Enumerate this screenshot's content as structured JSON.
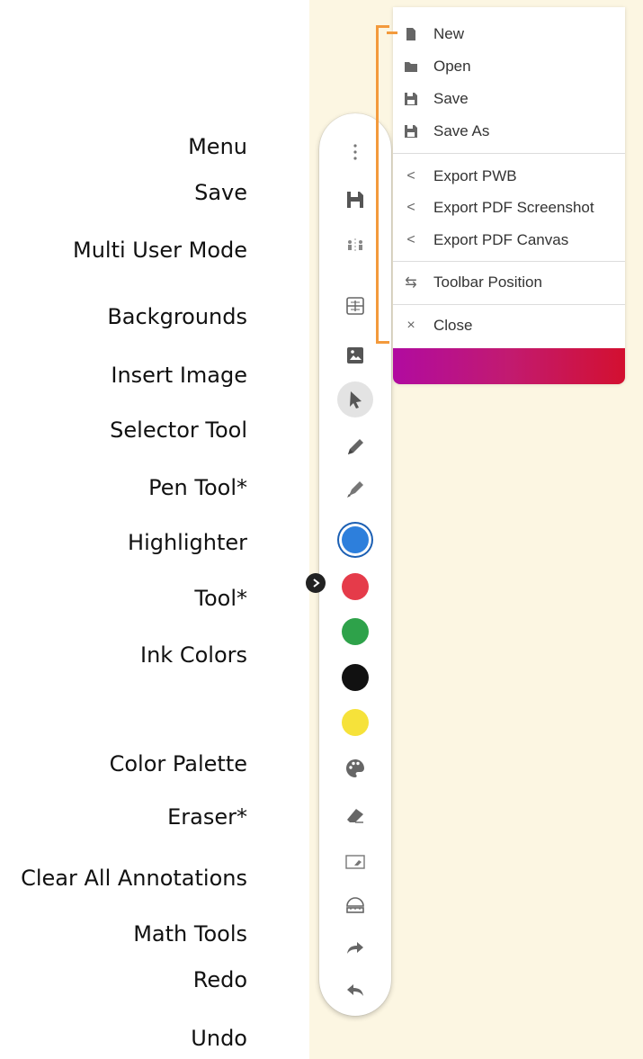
{
  "labels": {
    "menu": "Menu",
    "save": "Save",
    "multi_user_mode": "Multi User Mode",
    "backgrounds": "Backgrounds",
    "insert_image": "Insert Image",
    "selector_tool": "Selector Tool",
    "pen_tool": "Pen Tool*",
    "highlighter": "Highlighter",
    "tool": "Tool*",
    "ink_colors": "Ink Colors",
    "color_palette": "Color Palette",
    "eraser": "Eraser*",
    "clear_all": "Clear All Annotations",
    "math_tools": "Math Tools",
    "redo": "Redo",
    "undo": "Undo"
  },
  "menu": {
    "items": [
      {
        "label": "New",
        "icon": "file-icon"
      },
      {
        "label": "Open",
        "icon": "folder-icon"
      },
      {
        "label": "Save",
        "icon": "floppy-icon"
      },
      {
        "label": "Save As",
        "icon": "floppy-icon"
      },
      {
        "label": "Export PWB",
        "icon": "share-icon"
      },
      {
        "label": "Export PDF Screenshot",
        "icon": "share-icon"
      },
      {
        "label": "Export PDF Canvas",
        "icon": "share-icon"
      },
      {
        "label": "Toolbar Position",
        "icon": "swap-icon"
      },
      {
        "label": "Close",
        "icon": "close-icon"
      }
    ]
  },
  "colors": {
    "ink": [
      "#2d7fdc",
      "#e53b4a",
      "#2ea24a",
      "#111111",
      "#f6e23a"
    ],
    "accent_bracket": "#f39a3c",
    "canvas_background": "#fcf6e2"
  }
}
